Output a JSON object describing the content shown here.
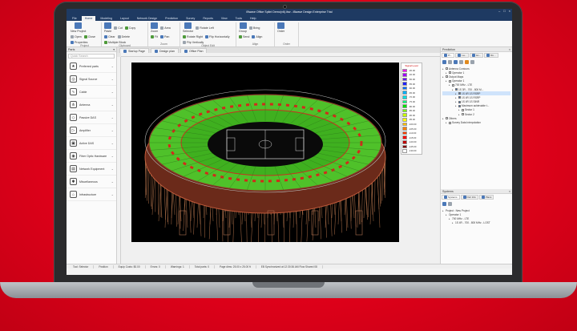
{
  "window": {
    "title": "iBwave Office Splint Demo(v6).ibw - iBwave Design Enterprise Trial"
  },
  "menu": {
    "tabs": [
      "File",
      "Home",
      "Modeling",
      "Layout",
      "Network Design",
      "Prediction",
      "Survey",
      "Reports",
      "View",
      "Tools",
      "Help"
    ]
  },
  "ribbon": {
    "groups": [
      {
        "label": "Project",
        "buttons": [
          "New Project",
          "Open",
          "Close",
          "Properties"
        ]
      },
      {
        "label": "Clipboard",
        "buttons": [
          "Paste",
          "Cut",
          "Copy",
          "Clear",
          "Delete",
          "Multiple Block"
        ]
      },
      {
        "label": "Zoom",
        "buttons": [
          "Zoom",
          "Area",
          "Fit",
          "Pan"
        ]
      },
      {
        "label": "Object Edit",
        "buttons": [
          "Selector",
          "Rotate Left",
          "Rotate Right",
          "Flip Horizontally",
          "Flip Vertically"
        ]
      },
      {
        "label": "Align",
        "buttons": [
          "Group",
          "Bring",
          "Send",
          "Align"
        ]
      },
      {
        "label": "Order",
        "buttons": [
          "Order"
        ]
      }
    ]
  },
  "parts": {
    "title": "Parts",
    "search_placeholder": "Quick Search",
    "items": [
      "Preferred parts",
      "Signal Source",
      "Cable",
      "Antenna",
      "Passive DAS",
      "Amplifier",
      "Active DAS",
      "Fiber Optic Hardware",
      "Network Equipment",
      "Miscellaneous",
      "Infrastructure"
    ]
  },
  "doc_tabs": [
    "Startup Page",
    "Design plan",
    "Office Plan"
  ],
  "legend": {
    "title": "Signal Level",
    "entries": [
      "-30.00",
      "-40.00",
      "-50.00",
      "-55.00",
      "-60.00",
      "-65.00",
      "-70.00",
      "-75.00",
      "-80.00",
      "-85.00",
      "-90.00",
      "-95.00",
      "-100.00",
      "-105.00",
      "-110.00",
      "-115.00",
      "-120.00",
      "-125.00",
      "-130.00"
    ],
    "colors": [
      "#ff00ff",
      "#a000ff",
      "#6a00ff",
      "#2020ff",
      "#0070ff",
      "#00b0ff",
      "#00e0e0",
      "#00ff80",
      "#00e000",
      "#80ff00",
      "#c8ff00",
      "#ffff00",
      "#ffc000",
      "#ff8000",
      "#ff4000",
      "#ff0000",
      "#c00000",
      "#800000",
      "#ffffff"
    ]
  },
  "prediction_panel": {
    "title": "Prediction",
    "tabs": [
      "Pr...",
      "La...",
      "Ex...",
      "Ro..."
    ],
    "tree": [
      {
        "label": "Antenna Contours",
        "level": 0,
        "checked": false
      },
      {
        "label": "Operator 1",
        "level": 1,
        "checked": false
      },
      {
        "label": "Output Maps",
        "level": 0,
        "checked": false
      },
      {
        "label": "Operator 1",
        "level": 1,
        "checked": false
      },
      {
        "label": "700 MHz - LTE",
        "level": 2,
        "checked": false
      },
      {
        "label": "1S 3R - 700 - 800 M...",
        "level": 3,
        "checked": true
      },
      {
        "label": "1S 4R 1S RSRP",
        "level": 4,
        "checked": true,
        "selected": true
      },
      {
        "label": "1S 4R 1S RSRP",
        "level": 4,
        "checked": true
      },
      {
        "label": "1S 4R 1S SINR",
        "level": 4,
        "checked": true
      },
      {
        "label": "Maximum achievable t...",
        "level": 4,
        "checked": true
      },
      {
        "label": "Sector 1",
        "level": 5,
        "checked": false
      },
      {
        "label": "Sector 2",
        "level": 5,
        "checked": false
      },
      {
        "label": "Others",
        "level": 0,
        "checked": false
      },
      {
        "label": "Survey Data Interpolation",
        "level": 1,
        "checked": false
      }
    ]
  },
  "systems_panel": {
    "title": "Systems",
    "tabs": [
      "Systems",
      "Part Info",
      "Plans"
    ],
    "tree": [
      {
        "label": "Project : New Project",
        "level": 0
      },
      {
        "label": "Operator 1",
        "level": 1
      },
      {
        "label": "700 MHz - LTE",
        "level": 2
      },
      {
        "label": "1S 4R - 700 - 800 MHz - LOST",
        "level": 3
      }
    ]
  },
  "statusbar": {
    "items": [
      "Tool: Selector",
      "Position",
      "Equip Costs: $0.00",
      "Errors: 0",
      "Warnings: 1",
      "Total parts: 0",
      "Page dims: 25.00 x 25.00 ft",
      "EB Synchronized at 12:30:36 AM Flow Shared 08"
    ]
  }
}
